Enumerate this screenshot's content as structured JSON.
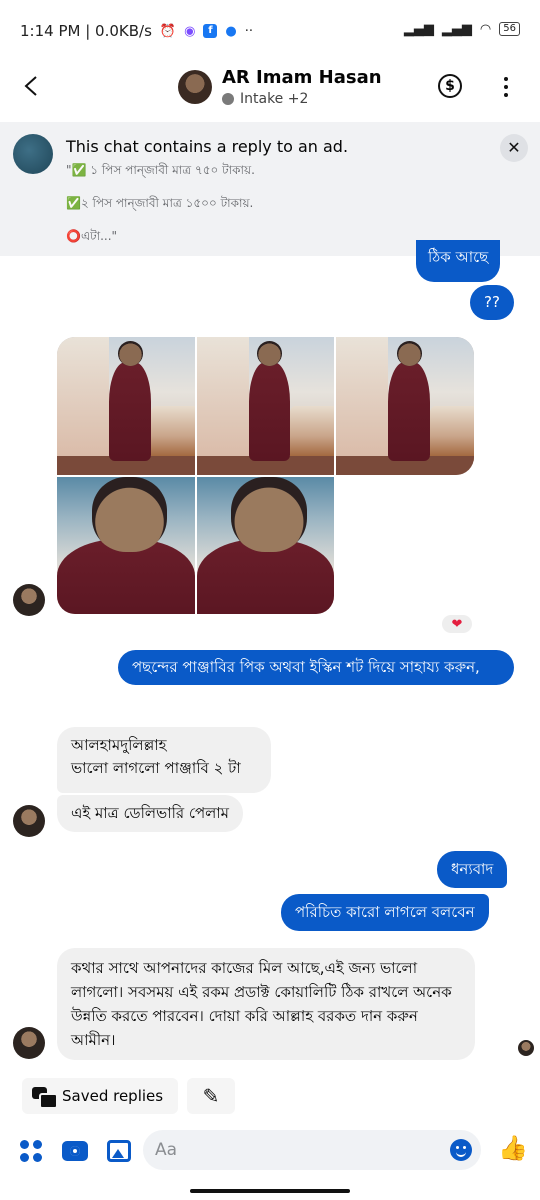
{
  "status_bar": {
    "time_network": "1:14 PM | 0.0KB/s",
    "battery": "56"
  },
  "header": {
    "name": "AR Imam Hasan",
    "subtitle": "Intake +2"
  },
  "ad_banner": {
    "title": "This chat contains a reply to an ad.",
    "line1": "\"✅ ১ পিস পান্জাবী মাত্র ৭৫০ টাকায়.",
    "line2": "✅২ পিস পান্জাবী মাত্র ১৫০০ টাকায়.",
    "line3": "⭕এটা...\""
  },
  "messages": {
    "m_okay": "ঠিক আছে",
    "m_qq": "??",
    "m_request": "পছন্দের পাঞ্জাবির পিক অথবা ইস্কিন শট দিয়ে সাহায্য করুন,",
    "m_alhamdulillah": "আলহামদুলিল্লাহ\nভালো লাগলো পাঞ্জাবি ২ টা",
    "m_delivery": "এই মাত্র ডেলিভারি পেলাম",
    "m_thanks": "ধন্যবাদ",
    "m_recommend": "পরিচিত কারো লাগলে বলবেন",
    "m_final": "কথার সাথে আপনাদের কাজের মিল আছে,এই জন্য ভালো লাগলো। সবসময় এই রকম প্রডাক্ট কোয়ালিটি ঠিক রাখলে অনেক উন্নতি করতে পারবেন। দোয়া করি আল্লাহ বরকত দান করুন আমীন।"
  },
  "reaction": "❤",
  "quick_bar": {
    "saved_replies": "Saved replies"
  },
  "composer": {
    "placeholder": "Aa"
  },
  "colors": {
    "accent": "#0a5ac8",
    "incoming_bubble": "#f0f0f0",
    "banner_bg": "#f1f2f4"
  }
}
